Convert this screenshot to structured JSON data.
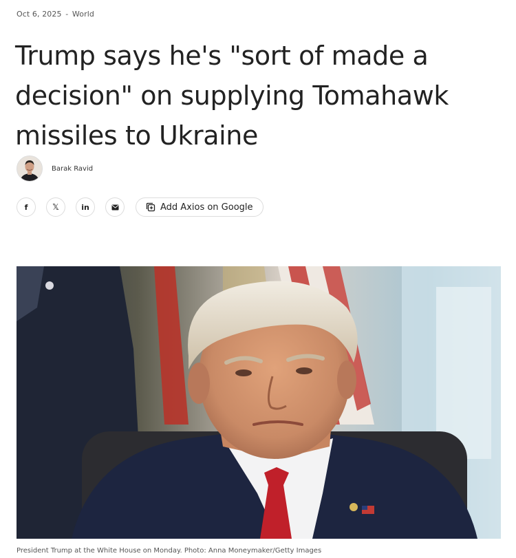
{
  "article": {
    "date": "Oct 6, 2025",
    "separator": "-",
    "section": "World",
    "headline": "Trump says he's \"sort of made a decision\" on supplying Tomahawk missiles to Ukraine",
    "author": "Barak Ravid",
    "image_caption": "President Trump at the White House on Monday. Photo: Anna Moneymaker/Getty Images"
  },
  "share": {
    "facebook_label": "f",
    "x_label": "𝕏",
    "linkedin_label": "in",
    "add_google_label": "Add Axios on Google"
  },
  "icons": {
    "facebook": "facebook-icon",
    "x": "x-icon",
    "linkedin": "linkedin-icon",
    "email": "email-icon",
    "add_google": "add-to-google-icon"
  },
  "colors": {
    "headline": "#222222",
    "meta": "#555555",
    "border": "#dcdcdc"
  }
}
